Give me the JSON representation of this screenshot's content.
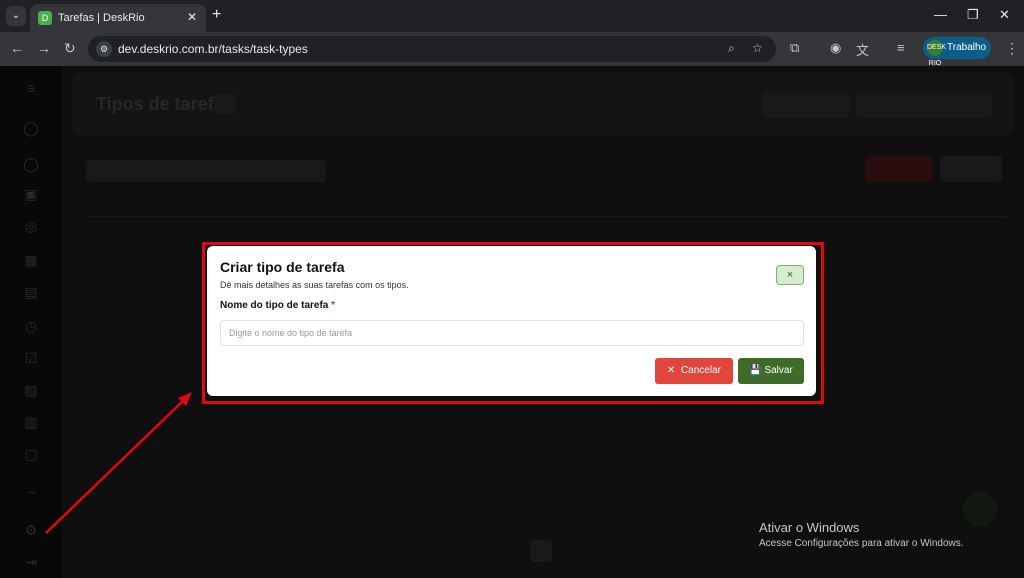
{
  "browser": {
    "tab_title": "Tarefas | DeskRio",
    "url": "dev.deskrio.com.br/tasks/task-types",
    "profile_name": "Trabalho",
    "profile_avatar": "DESK RIO"
  },
  "page": {
    "title": "Tipos de tarefa"
  },
  "modal": {
    "title": "Criar tipo de tarefa",
    "subtitle": "Dê mais detalhes as suas tarefas com os tipos.",
    "field_label": "Nome do tipo de tarefa",
    "required_mark": "*",
    "field_placeholder": "Digite o nome do tipo de tarefa",
    "field_value": "",
    "close_label": "×",
    "cancel_label": "Cancelar",
    "save_label": "Salvar"
  },
  "watermark": {
    "line1": "Ativar o Windows",
    "line2": "Acesse Configurações para ativar o Windows."
  },
  "colors": {
    "highlight": "#e30613",
    "cancel": "#e0463c",
    "save": "#3f6b2a"
  }
}
